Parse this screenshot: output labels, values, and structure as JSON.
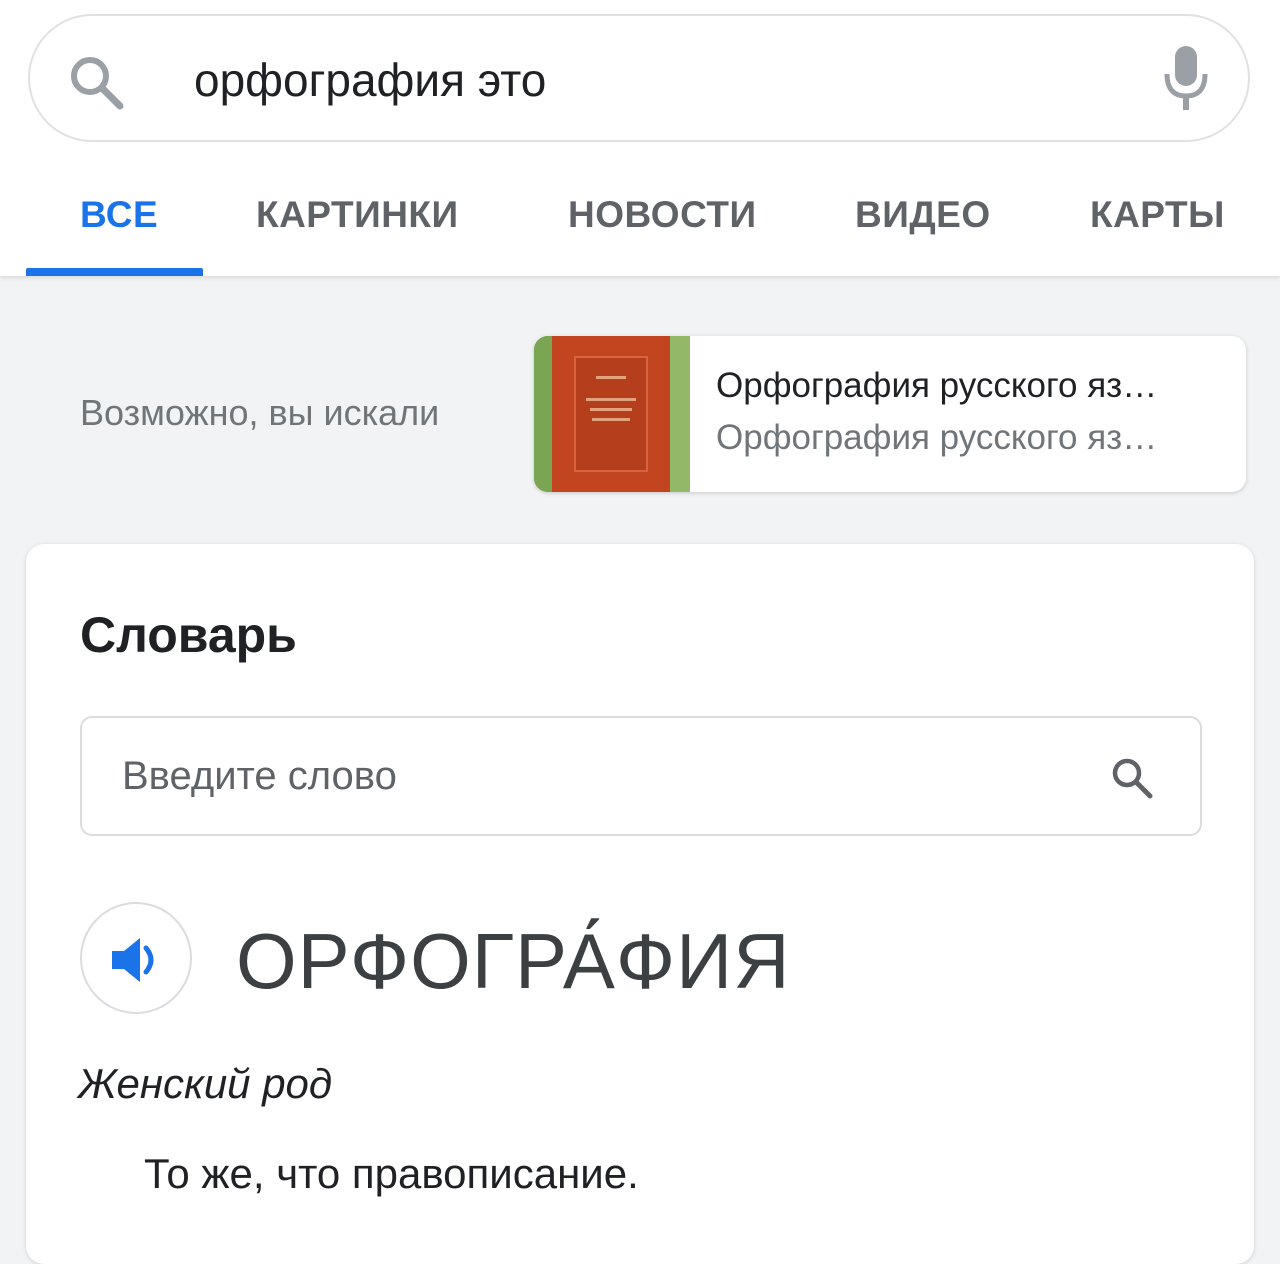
{
  "search": {
    "query": "орфография это",
    "icons": {
      "search": "search-icon",
      "voice": "microphone-icon"
    }
  },
  "tabs": [
    {
      "label": "ВСЕ",
      "active": true
    },
    {
      "label": "КАРТИНКИ",
      "active": false
    },
    {
      "label": "НОВОСТИ",
      "active": false
    },
    {
      "label": "ВИДЕО",
      "active": false
    },
    {
      "label": "КАРТЫ",
      "active": false
    }
  ],
  "suggestion": {
    "label": "Возможно, вы искали",
    "title": "Орфография русского яз…",
    "subtitle": "Орфография русского яз…"
  },
  "dictionary": {
    "heading": "Словарь",
    "input_placeholder": "Введите слово",
    "word": "ОРФОГРА́ФИЯ",
    "part_of_speech": "Женский род",
    "definition": "То же, что правописание.",
    "icons": {
      "search": "search-icon",
      "speaker": "speaker-icon"
    }
  },
  "colors": {
    "accent": "#1a73e8",
    "text": "#202124",
    "muted": "#70757a",
    "background": "#f1f3f4"
  }
}
